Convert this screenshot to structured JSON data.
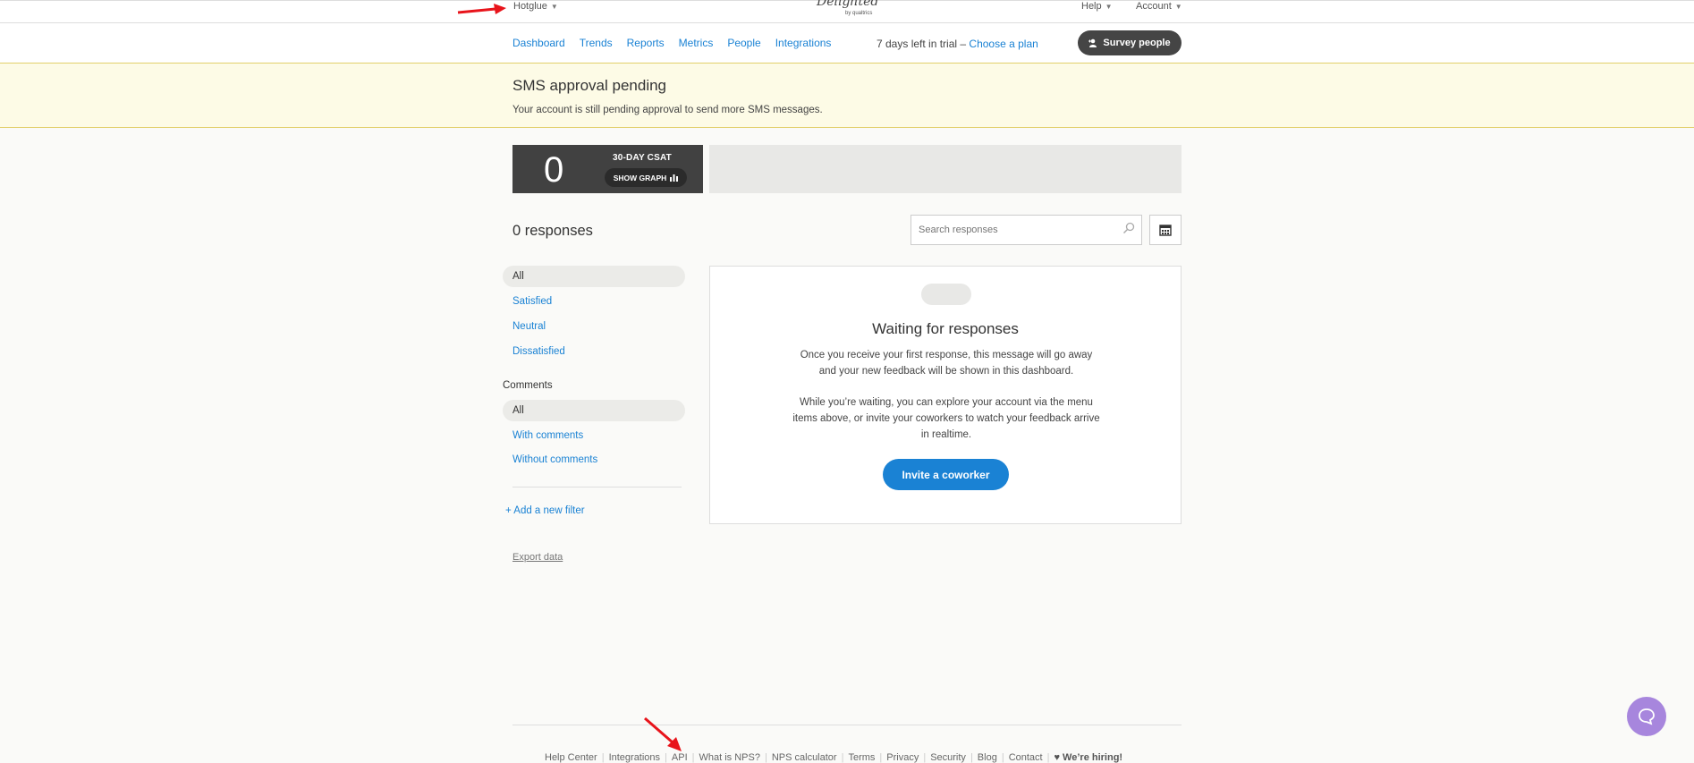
{
  "topbar": {
    "org_name": "Hotglue",
    "logo_text": "Delighted",
    "logo_sub": "by qualtrics",
    "help_label": "Help",
    "account_label": "Account"
  },
  "nav": {
    "items": [
      "Dashboard",
      "Trends",
      "Reports",
      "Metrics",
      "People",
      "Integrations"
    ],
    "trial_text": "7 days left in trial –",
    "choose_plan": "Choose a plan",
    "survey_button": "Survey people"
  },
  "banner": {
    "title": "SMS approval pending",
    "message": "Your account is still pending approval to send more SMS messages."
  },
  "csat": {
    "value": "0",
    "label": "30-DAY CSAT",
    "show_graph": "SHOW GRAPH"
  },
  "responses": {
    "count_label": "0 responses",
    "search_placeholder": "Search responses"
  },
  "filters": {
    "all": "All",
    "satisfied": "Satisfied",
    "neutral": "Neutral",
    "dissatisfied": "Dissatisfied",
    "comments_label": "Comments",
    "comments_all": "All",
    "with_comments": "With comments",
    "without_comments": "Without comments",
    "add_filter": "+ Add a new filter",
    "export": "Export data"
  },
  "waiting": {
    "title": "Waiting for responses",
    "p1": "Once you receive your first response, this message will go away and your new feedback will be shown in this dashboard.",
    "p2": "While you’re waiting, you can explore your account via the menu items above, or invite your coworkers to watch your feedback arrive in realtime.",
    "invite_button": "Invite a coworker"
  },
  "footer": {
    "links": [
      "Help Center",
      "Integrations",
      "API",
      "What is NPS?",
      "NPS calculator",
      "Terms",
      "Privacy",
      "Security",
      "Blog",
      "Contact"
    ],
    "hiring": "♥ We’re hiring!"
  },
  "colors": {
    "link": "#1a82d4",
    "banner_bg": "#fdfbe6",
    "dark": "#414141",
    "chat": "#a786dd",
    "annotation": "#e8141b"
  }
}
